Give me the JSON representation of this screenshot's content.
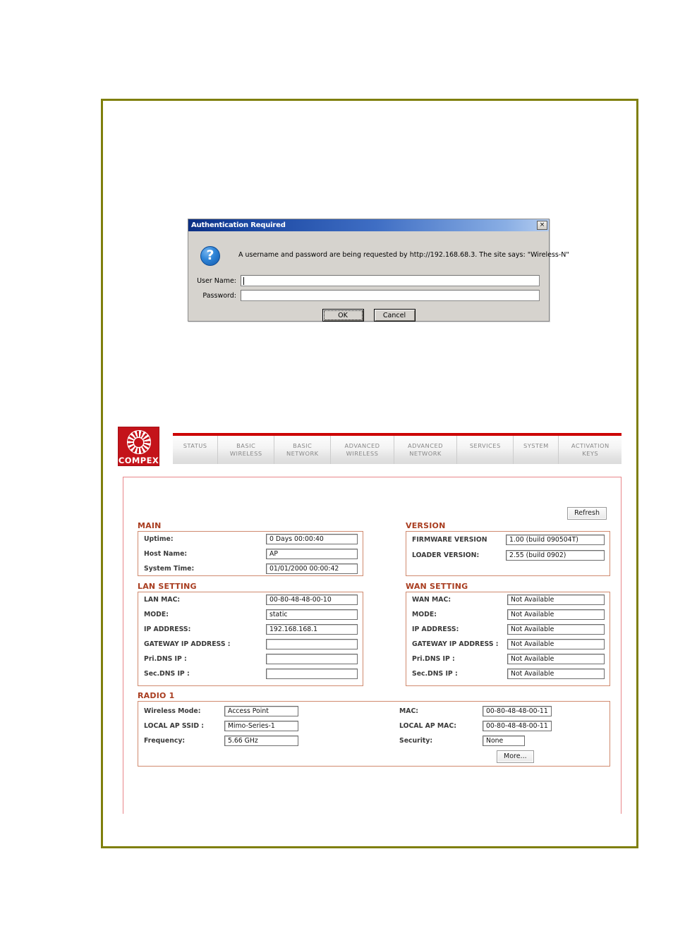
{
  "auth_dialog": {
    "title": "Authentication Required",
    "close_label": "×",
    "icon": "question-icon",
    "message": "A username and password are being requested by http://192.168.68.3. The site says: \"Wireless-N\"",
    "username_label": "User Name:",
    "username_value": "",
    "password_label": "Password:",
    "password_value": "",
    "ok_label": "OK",
    "cancel_label": "Cancel"
  },
  "router": {
    "brand": "COMPEX",
    "tabs": [
      {
        "label": "STATUS"
      },
      {
        "label": "BASIC\nWIRELESS"
      },
      {
        "label": "BASIC\nNETWORK"
      },
      {
        "label": "ADVANCED\nWIRELESS"
      },
      {
        "label": "ADVANCED\nNETWORK"
      },
      {
        "label": "SERVICES"
      },
      {
        "label": "SYSTEM"
      },
      {
        "label": "ACTIVATION\nKEYS"
      }
    ],
    "refresh_label": "Refresh",
    "more_label": "More...",
    "sections": {
      "main": {
        "title": "MAIN",
        "rows": [
          {
            "label": "Uptime:",
            "value": "0 Days 00:00:40"
          },
          {
            "label": "Host Name:",
            "value": "AP"
          },
          {
            "label": "System Time:",
            "value": "01/01/2000 00:00:42"
          }
        ]
      },
      "version": {
        "title": "VERSION",
        "rows": [
          {
            "label": "FIRMWARE VERSION",
            "value": "1.00 (build 090504T)"
          },
          {
            "label": "LOADER VERSION:",
            "value": "2.55 (build 0902)"
          }
        ]
      },
      "lan": {
        "title": "LAN SETTING",
        "rows": [
          {
            "label": "LAN MAC:",
            "value": "00-80-48-48-00-10"
          },
          {
            "label": "MODE:",
            "value": "static"
          },
          {
            "label": "IP ADDRESS:",
            "value": "192.168.168.1"
          },
          {
            "label": "GATEWAY IP ADDRESS :",
            "value": ""
          },
          {
            "label": "Pri.DNS IP :",
            "value": ""
          },
          {
            "label": "Sec.DNS IP :",
            "value": ""
          }
        ]
      },
      "wan": {
        "title": "WAN SETTING",
        "rows": [
          {
            "label": "WAN MAC:",
            "value": "Not Available"
          },
          {
            "label": "MODE:",
            "value": "Not Available"
          },
          {
            "label": "IP ADDRESS:",
            "value": "Not Available"
          },
          {
            "label": "GATEWAY IP ADDRESS :",
            "value": "Not Available"
          },
          {
            "label": "Pri.DNS IP :",
            "value": "Not Available"
          },
          {
            "label": "Sec.DNS IP :",
            "value": "Not Available"
          }
        ]
      },
      "radio": {
        "title": "RADIO 1",
        "left_rows": [
          {
            "label": "Wireless Mode:",
            "value": "Access Point"
          },
          {
            "label": "LOCAL AP SSID :",
            "value": "Mimo-Series-1"
          },
          {
            "label": "Frequency:",
            "value": "5.66 GHz"
          }
        ],
        "right_rows": [
          {
            "label": "MAC:",
            "value": "00-80-48-48-00-11"
          },
          {
            "label": "LOCAL AP MAC:",
            "value": "00-80-48-48-00-11"
          },
          {
            "label": "Security:",
            "value": "None"
          }
        ]
      }
    }
  },
  "colors": {
    "page_frame": "#7f7f0c",
    "brand_red": "#c4131a",
    "tab_rule": "#cc0000",
    "section_heading": "#a93d20",
    "section_border": "#d08a6e",
    "panel_border": "#e8868a",
    "titlebar_start": "#0b2f84",
    "titlebar_end": "#b5cdf0"
  }
}
